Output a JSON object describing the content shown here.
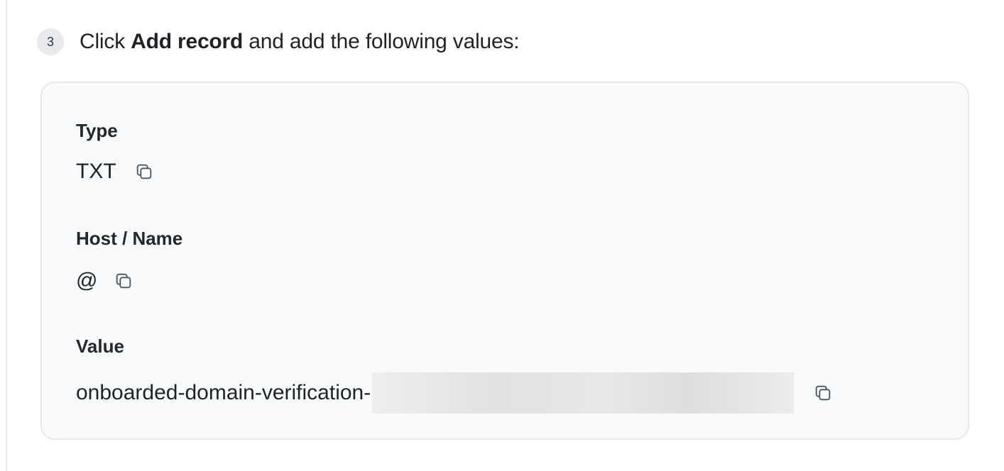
{
  "step": {
    "number": "3",
    "prefix": "Click ",
    "emphasis": "Add record",
    "suffix": " and add the following values:"
  },
  "record": {
    "type_label": "Type",
    "type_value": "TXT",
    "host_label": "Host / Name",
    "host_value": "@",
    "value_label": "Value",
    "value_prefix": "onboarded-domain-verification-"
  },
  "icons": {
    "copy": "copy-icon"
  },
  "colors": {
    "card_background": "#f9fafb",
    "card_border": "#e6e9ee",
    "badge_background": "#e8eaee"
  }
}
